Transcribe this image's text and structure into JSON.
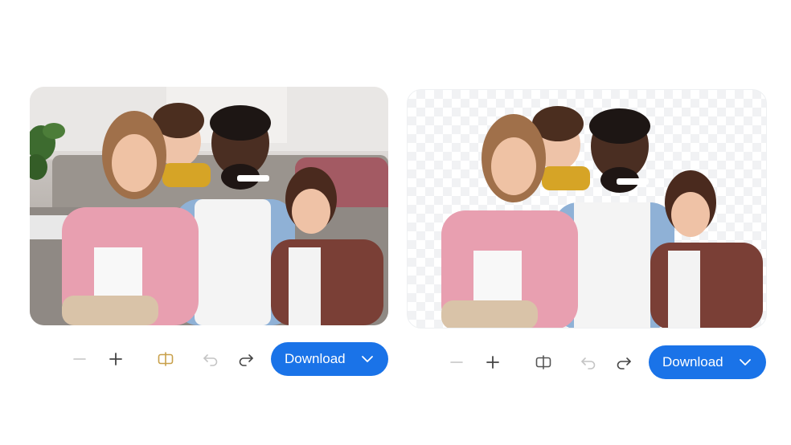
{
  "panels": [
    {
      "id": "original",
      "photo_alt": "family-photo-original",
      "toolbar": {
        "download_label": "Download",
        "compare_icon_color": "#c8a04a"
      }
    },
    {
      "id": "background-removed",
      "photo_alt": "family-photo-background-removed",
      "toolbar": {
        "download_label": "Download",
        "compare_icon_color": "#555555"
      }
    }
  ],
  "colors": {
    "accent": "#1a73e8",
    "icon_default": "#444444",
    "icon_disabled": "#c4c4c4"
  },
  "icons": [
    "zoom-out-icon",
    "zoom-in-icon",
    "compare-icon",
    "undo-icon",
    "redo-icon",
    "chevron-down-icon"
  ]
}
